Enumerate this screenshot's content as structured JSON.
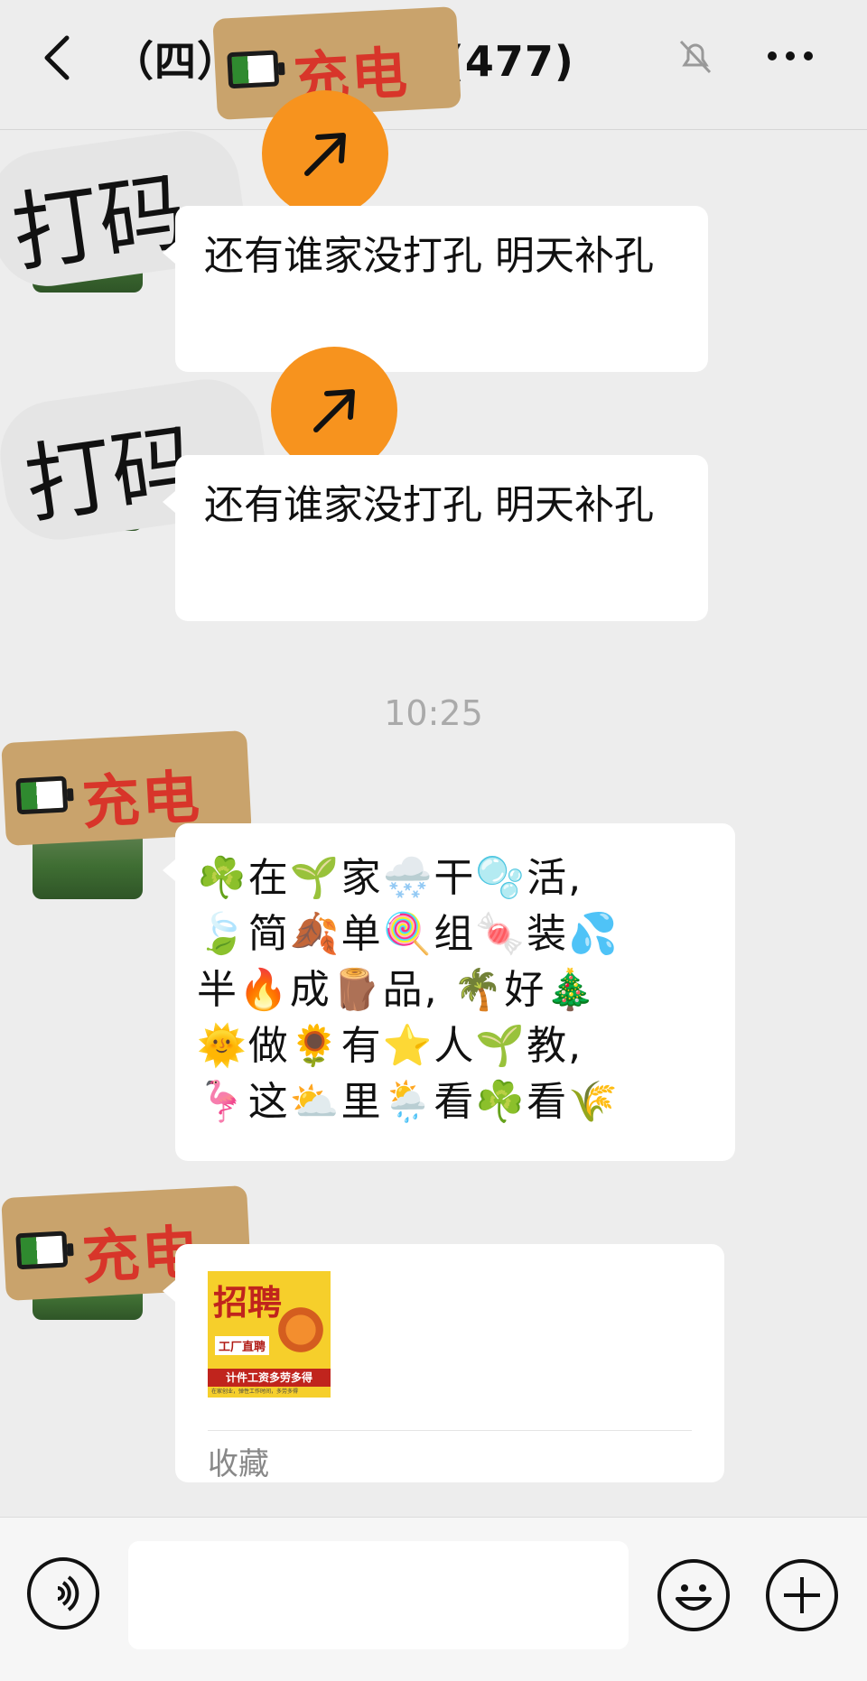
{
  "header": {
    "title": "（四）🏠 2#—2(477)"
  },
  "stickers": {
    "battery_text": "充电",
    "code_text": "打码"
  },
  "messages": [
    {
      "text": "还有谁家没打孔 明天补孔"
    },
    {
      "text": "还有谁家没打孔 明天补孔"
    }
  ],
  "timestamp": "10:25",
  "emoji_message": {
    "lines": [
      "☘️在🌱家🌨️干🫧活,",
      "🍃简🍂单🍭组🍬装💦",
      "半🔥成🪵品, 🌴好🎄",
      "🌞做🌻有⭐人🌱教,",
      "🦩这⛅里🌦️看☘️看🌾"
    ]
  },
  "favorite_card": {
    "image_heading": "招聘",
    "image_tag": "工厂直聘",
    "image_band": "计件工资多劳多得",
    "image_footnote": "在家创业，弹性工作时间，多劳多得",
    "label": "收藏"
  },
  "icons": {
    "back": "chevron-left-icon",
    "mute": "bell-off-icon",
    "more": "more-dots-icon",
    "voice": "voice-icon",
    "emoji": "smiley-icon",
    "plus": "plus-icon"
  }
}
